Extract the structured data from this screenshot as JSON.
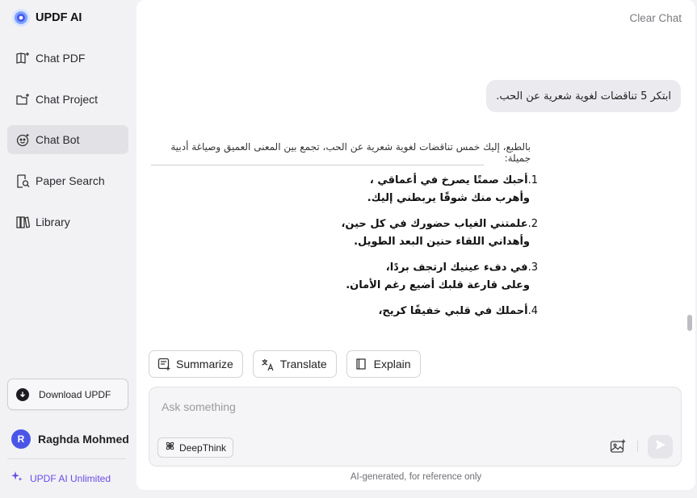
{
  "brand": {
    "name": "UPDF AI"
  },
  "sidebar": {
    "items": [
      {
        "label": "Chat PDF",
        "icon": "book-sparkle-icon"
      },
      {
        "label": "Chat Project",
        "icon": "folder-sparkle-icon"
      },
      {
        "label": "Chat Bot",
        "icon": "bot-face-icon",
        "active": true
      },
      {
        "label": "Paper Search",
        "icon": "doc-search-icon"
      },
      {
        "label": "Library",
        "icon": "library-icon"
      }
    ],
    "download_label": "Download UPDF",
    "user": {
      "initial": "R",
      "name": "Raghda Mohmed"
    },
    "unlimited_label": "UPDF AI Unlimited"
  },
  "main": {
    "clear_chat": "Clear Chat",
    "user_message": "ابتكر 5 تناقضات لغوية شعرية عن الحب.",
    "answer_intro": "بالطبع، إليك خمس تناقضات لغوية شعرية عن الحب، تجمع بين المعنى العميق وصياغة أدبية جميلة:",
    "poem": [
      {
        "num": "1.",
        "line1": "أحبك صمتًا يصرخ في أعماقي ،",
        "line2": "وأهرب منك شوقًا يربطني إليك."
      },
      {
        "num": "2.",
        "line1": "علمتني الغياب حضورك في كل حين،",
        "line2": "وأهداني اللقاء حنين البعد الطويل."
      },
      {
        "num": "3.",
        "line1": "في دفء عينيك ارتجف بردًا،",
        "line2": "وعلى قارعة قلبك أضيع رغم الأمان."
      },
      {
        "num": "4.",
        "line1": "أحملك في قلبي خفيفًا كريح،",
        "line2": ""
      }
    ],
    "actions": [
      {
        "label": "Summarize",
        "icon": "summarize-icon"
      },
      {
        "label": "Translate",
        "icon": "translate-icon"
      },
      {
        "label": "Explain",
        "icon": "book-icon"
      }
    ],
    "composer": {
      "placeholder": "Ask something",
      "deepthink_label": "DeepThink"
    },
    "disclaimer": "AI-generated, for reference only"
  },
  "colors": {
    "accent": "#4a55e8",
    "unlimited": "#6b4ce6",
    "active_nav": "#e2e2e6"
  }
}
